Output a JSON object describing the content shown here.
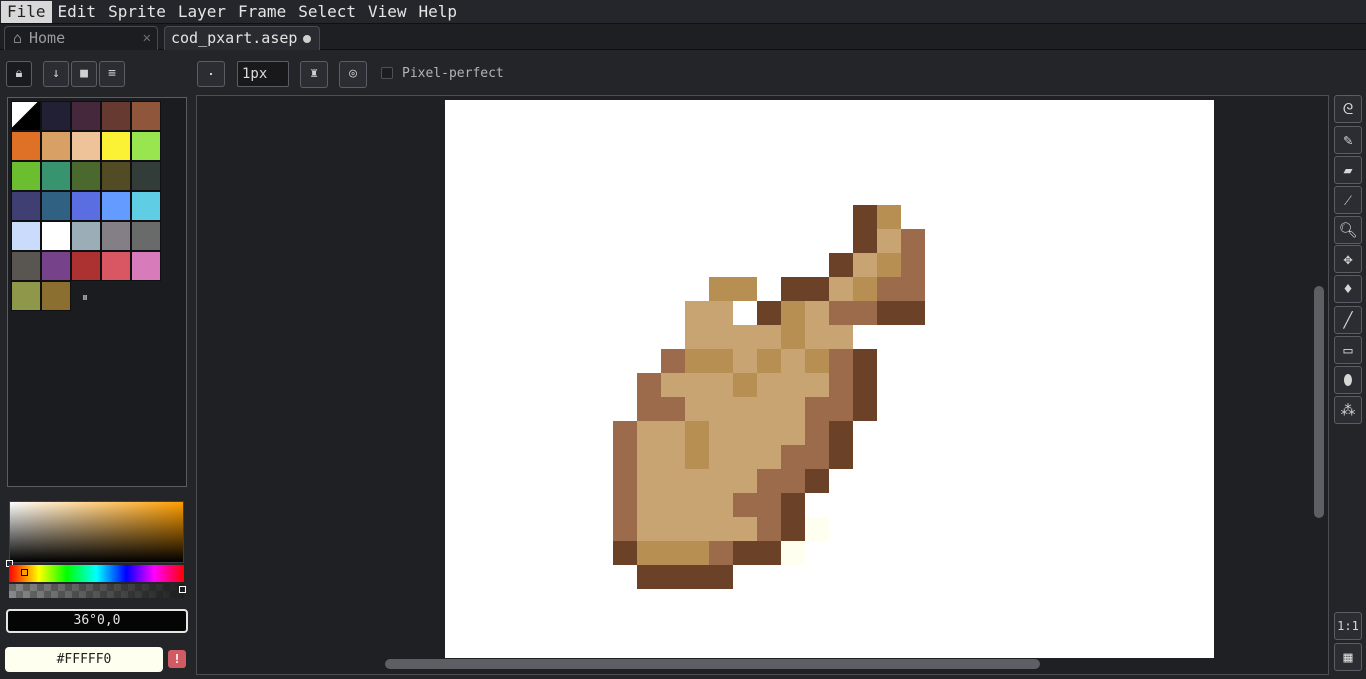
{
  "menu": [
    "File",
    "Edit",
    "Sprite",
    "Layer",
    "Frame",
    "Select",
    "View",
    "Help"
  ],
  "tabs": {
    "home": "Home",
    "file": "cod_pxart.asep"
  },
  "brush": {
    "size": "1px"
  },
  "pixel_perfect": "Pixel-perfect",
  "palette": [
    "#000000",
    "#222034",
    "#45283c",
    "#663931",
    "#8f563b",
    "#df7126",
    "#d9a066",
    "#eec39a",
    "#fbf236",
    "#99e550",
    "#6abe30",
    "#37946e",
    "#4b692f",
    "#524b24",
    "#323c39",
    "#3f3f74",
    "#306082",
    "#5b6ee1",
    "#639bff",
    "#5fcde4",
    "#cbdbfc",
    "#ffffff",
    "#9badb7",
    "#847e87",
    "#696a6a",
    "#595652",
    "#76428a",
    "#ac3232",
    "#d95763",
    "#d77bba",
    "#8f974a",
    "#8a6f30"
  ],
  "palette_handle": "⏸",
  "color": {
    "readout": "36°0,0",
    "hex": "#FFFFF0",
    "warning": "!"
  },
  "sprite": {
    "colors": {
      "D": "#6b4128",
      "M": "#9b6b4c",
      "L": "#c8a472",
      "S": "#b88f52",
      "W": "#fffff0"
    },
    "rows": [
      "..........DS....",
      "..........DLM...",
      ".........DLSM...",
      "....SS.DDLSMM...",
      "...LL.DSLMMDD...",
      "...LLLLSLL......",
      "..MSSLSLSMD.....",
      ".MLLLSLLLMD.....",
      ".MMLLLLLMMD.....",
      "MLLSLLLLMD......",
      "MLLSLLLMMD......",
      "MLLLLLMMD.......",
      "MLLLLMMD........",
      "MLLLLLMDW.......",
      "DSSSMDDW........",
      ".DDDD..........."
    ]
  },
  "tools": [
    "lasso",
    "pencil",
    "eraser",
    "eyedropper",
    "zoom",
    "move",
    "paint-bucket",
    "line",
    "rectangle",
    "ellipse",
    "spray"
  ],
  "bottom_tools": [
    "1:1",
    "timeline"
  ]
}
